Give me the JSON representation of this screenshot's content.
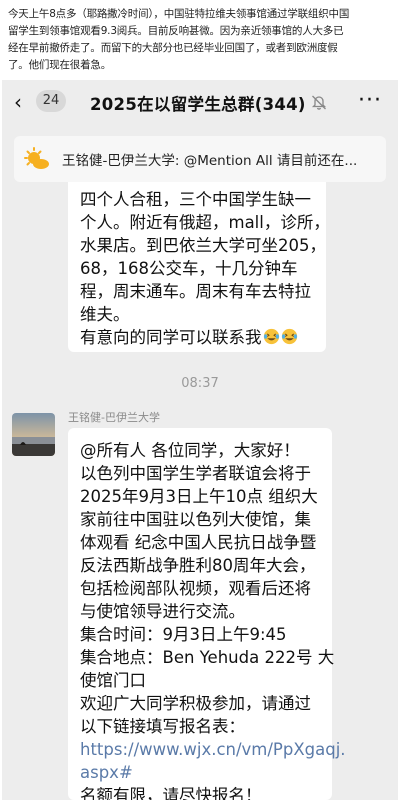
{
  "caption": {
    "lines": [
      "今天上午8点多（耶路撒冷时间），中国驻特拉维夫领事馆通过学联组织中国",
      "留学生到领事馆观看9.3阅兵。目前反响甚微。因为亲近领事馆的人大多已",
      "经在早前撤侨走了。而留下的大部分也已经毕业回国了，或者到欧洲度假",
      "了。他们现在很着急。"
    ]
  },
  "chat": {
    "back_glyph": "‹",
    "unread_count": "24",
    "title": "2025在以留学生总群(344)",
    "more_glyph": "···",
    "pinned_text": "王铭健-巴伊兰大学: @Mention All 请目前还在...",
    "timestamp": "08:37",
    "sender_name": "王铭健-巴伊兰大学"
  },
  "message1": {
    "lines": [
      "四个人合租，三个中国学生缺一",
      "个人。附近有俄超，mall，诊所，",
      "水果店。到巴依兰大学可坐205，",
      "68，168公交车，十几分钟车",
      "程，周末通车。周末有车去特拉",
      "维夫。",
      "有意向的同学可以联系我"
    ]
  },
  "message2": {
    "lines": [
      "@所有人 各位同学，大家好！",
      "以色列中国学生学者联谊会将于",
      "2025年9月3日上午10点 组织大",
      "家前往中国驻以色列大使馆，集",
      "体观看 纪念中国人民抗日战争暨",
      "反法西斯战争胜利80周年大会，",
      "包括检阅部队视频，观看后还将",
      "与使馆领导进行交流。",
      "集合时间：9月3日上午9:45",
      "集合地点：Ben Yehuda 222号 大",
      "使馆门口",
      "欢迎广大同学积极参加，请通过",
      "以下链接填写报名表："
    ],
    "link_lines": [
      "https://www.wjx.cn/vm/PpXgaqj.",
      "aspx#"
    ],
    "last_line": "名额有限，请尽快报名！"
  },
  "colors": {
    "chat_bg": "#ededed",
    "bubble": "#ffffff",
    "link": "#5a7aa8",
    "timestamp": "#9a9a9a"
  },
  "icons": [
    "back-arrow-icon",
    "mute-bell-icon",
    "more-icon",
    "sun-emoji-icon",
    "laughing-crying-emoji-icon"
  ]
}
